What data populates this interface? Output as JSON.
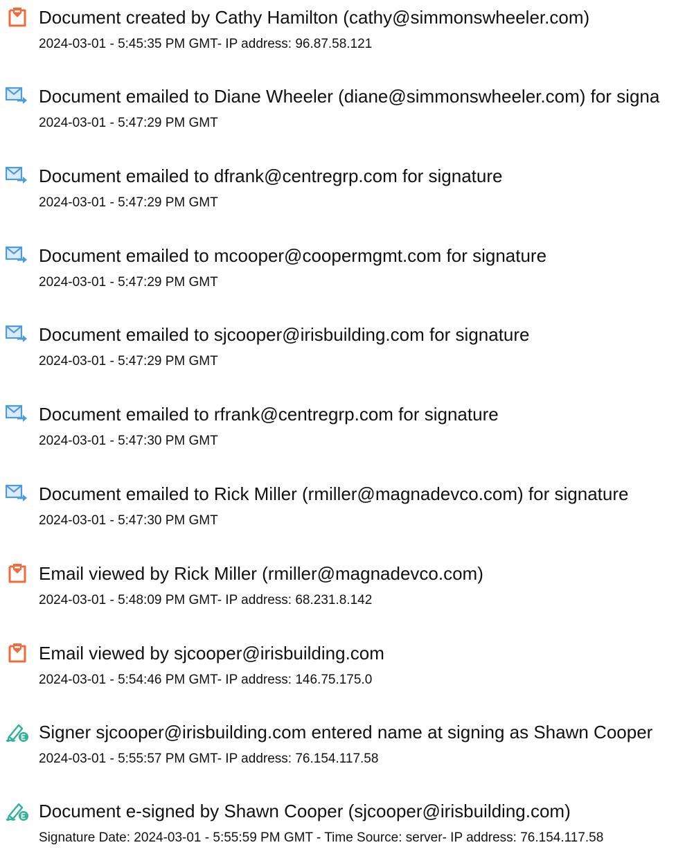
{
  "events": [
    {
      "icon": "document-created-icon",
      "title": "Document created by Cathy Hamilton (cathy@simmonswheeler.com)",
      "detail": "2024-03-01 - 5:45:35 PM GMT- IP address: 96.87.58.121"
    },
    {
      "icon": "email-sent-icon",
      "title": "Document emailed to Diane Wheeler (diane@simmonswheeler.com) for signa",
      "detail": "2024-03-01 - 5:47:29 PM GMT"
    },
    {
      "icon": "email-sent-icon",
      "title": "Document emailed to dfrank@centregrp.com for signature",
      "detail": "2024-03-01 - 5:47:29 PM GMT"
    },
    {
      "icon": "email-sent-icon",
      "title": "Document emailed to mcooper@coopermgmt.com for signature",
      "detail": "2024-03-01 - 5:47:29 PM GMT"
    },
    {
      "icon": "email-sent-icon",
      "title": "Document emailed to sjcooper@irisbuilding.com for signature",
      "detail": "2024-03-01 - 5:47:29 PM GMT"
    },
    {
      "icon": "email-sent-icon",
      "title": "Document emailed to rfrank@centregrp.com for signature",
      "detail": "2024-03-01 - 5:47:30 PM GMT"
    },
    {
      "icon": "email-sent-icon",
      "title": "Document emailed to Rick Miller (rmiller@magnadevco.com) for signature",
      "detail": "2024-03-01 - 5:47:30 PM GMT"
    },
    {
      "icon": "email-viewed-icon",
      "title": "Email viewed by Rick Miller (rmiller@magnadevco.com)",
      "detail": "2024-03-01 - 5:48:09 PM GMT- IP address: 68.231.8.142"
    },
    {
      "icon": "email-viewed-icon",
      "title": "Email viewed by sjcooper@irisbuilding.com",
      "detail": "2024-03-01 - 5:54:46 PM GMT- IP address: 146.75.175.0"
    },
    {
      "icon": "e-sign-pen-icon",
      "title": "Signer sjcooper@irisbuilding.com entered name at signing as Shawn Cooper",
      "detail": "2024-03-01 - 5:55:57 PM GMT- IP address: 76.154.117.58"
    },
    {
      "icon": "e-sign-pen-icon",
      "title": "Document e-signed by Shawn Cooper (sjcooper@irisbuilding.com)",
      "detail": "Signature Date: 2024-03-01 - 5:55:59 PM GMT - Time Source: server- IP address: 76.154.117.58"
    }
  ],
  "colors": {
    "document_icon": "#f06a3c",
    "email_icon": "#4a9be0",
    "email_icon_light": "#dbeaf8",
    "sign_icon": "#2eb39a",
    "text": "#111111"
  }
}
